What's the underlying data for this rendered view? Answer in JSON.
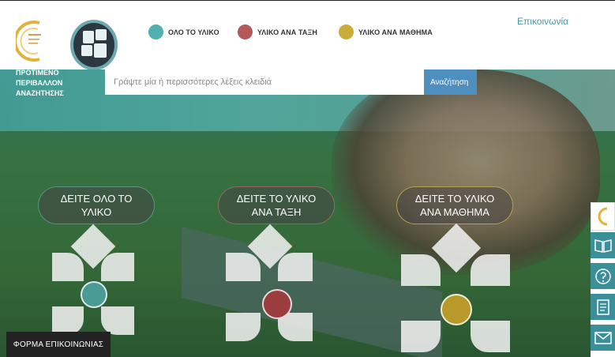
{
  "header": {
    "nav": [
      {
        "label": "ΟΛΟ ΤΟ ΥΛΙΚΟ",
        "color": "#4fb0ad"
      },
      {
        "label": "ΥΛΙΚΟ ΑΝΑ ΤΑΞΗ",
        "color": "#b4585a"
      },
      {
        "label": "ΥΛΙΚΟ ΑΝΑ ΜΑΘΗΜΑ",
        "color": "#c9ac3a"
      }
    ],
    "contact_link": "Επικοινωνία"
  },
  "search": {
    "label": "ΠΡΟΤΙΜΕΝΟ ΠΕΡΙΒΑΛΛΟΝ ΑΝΑΖΗΤΗΣΗΣ",
    "placeholder": "Γράψτε μία ή περισσότερες λέξεις κλειδιά",
    "button": "Αναζήτηση"
  },
  "cards": [
    {
      "label": "ΔΕΙΤΕ ΟΛΟ ΤΟ ΥΛΙΚΟ",
      "color": "#4a9a96"
    },
    {
      "label": "ΔΕΙΤΕ ΤΟ ΥΛΙΚΟ ΑΝΑ ΤΑΞΗ",
      "color": "#9a3d3f"
    },
    {
      "label": "ΔΕΙΤΕ ΤΟ ΥΛΙΚΟ ΑΝΑ ΜΑΘΗΜΑ",
      "color": "#b89a2a"
    }
  ],
  "sidebar": {
    "icons": [
      "logo-icon",
      "book-icon",
      "question-icon",
      "document-icon",
      "mail-icon"
    ]
  },
  "contact_form": "ΦΟΡΜΑ ΕΠΙΚΟΙΝΩΝΙΑΣ"
}
